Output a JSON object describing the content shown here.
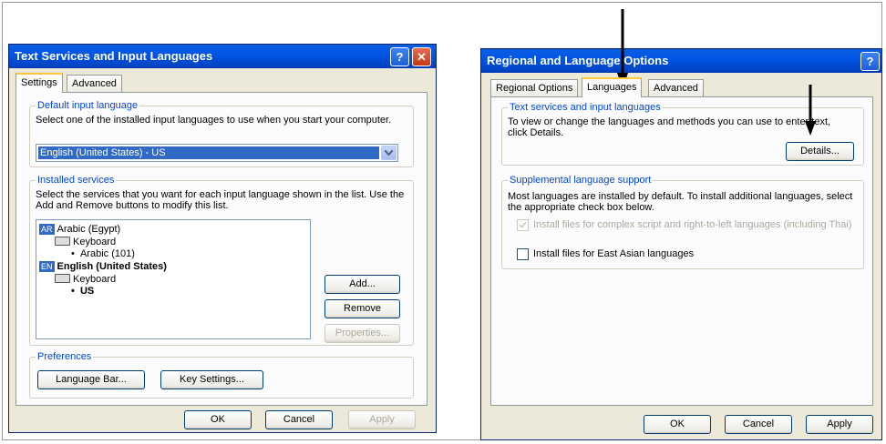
{
  "left_dialog": {
    "title": "Text Services and Input Languages",
    "help_glyph": "?",
    "close_glyph": "✕",
    "tabs": [
      {
        "label": "Settings",
        "active": true
      },
      {
        "label": "Advanced",
        "active": false
      }
    ],
    "default_input": {
      "group_title": "Default input language",
      "description": "Select one of the installed input languages to use when you start your computer.",
      "selected_value": "English (United States) - US"
    },
    "installed": {
      "group_title": "Installed services",
      "description": "Select the services that you want for each input language shown in the list. Use the Add and Remove buttons to modify this list.",
      "languages": [
        {
          "tag": "AR",
          "name": "Arabic (Egypt)",
          "category": "Keyboard",
          "layout": "Arabic (101)",
          "bold": false
        },
        {
          "tag": "EN",
          "name": "English (United States)",
          "category": "Keyboard",
          "layout": "US",
          "bold": true
        }
      ],
      "buttons": {
        "add": "Add...",
        "remove": "Remove",
        "properties": "Properties..."
      }
    },
    "preferences": {
      "group_title": "Preferences",
      "language_bar": "Language Bar...",
      "key_settings": "Key Settings..."
    },
    "footer": {
      "ok": "OK",
      "cancel": "Cancel",
      "apply": "Apply"
    }
  },
  "right_dialog": {
    "title": "Regional and Language Options",
    "help_glyph": "?",
    "tabs": [
      {
        "label": "Regional Options",
        "active": false
      },
      {
        "label": "Languages",
        "active": true
      },
      {
        "label": "Advanced",
        "active": false
      }
    ],
    "text_services": {
      "group_title": "Text services and input languages",
      "description": "To view or change the languages and methods you can use to enter text, click Details.",
      "details_button": "Details..."
    },
    "supplemental": {
      "group_title": "Supplemental language support",
      "description": "Most languages are installed by default. To install additional languages, select the appropriate check box below.",
      "checkbox_complex": "Install files for complex script and right-to-left languages (including Thai)",
      "checkbox_complex_checked": true,
      "checkbox_east_asian": "Install files for East Asian languages",
      "checkbox_east_asian_checked": false
    },
    "footer": {
      "ok": "OK",
      "cancel": "Cancel",
      "apply": "Apply"
    }
  },
  "colors": {
    "title_bar": "#0054e3",
    "group_title": "#0046d5",
    "selection": "#316ac5",
    "dialog_bg": "#ece9d8"
  }
}
